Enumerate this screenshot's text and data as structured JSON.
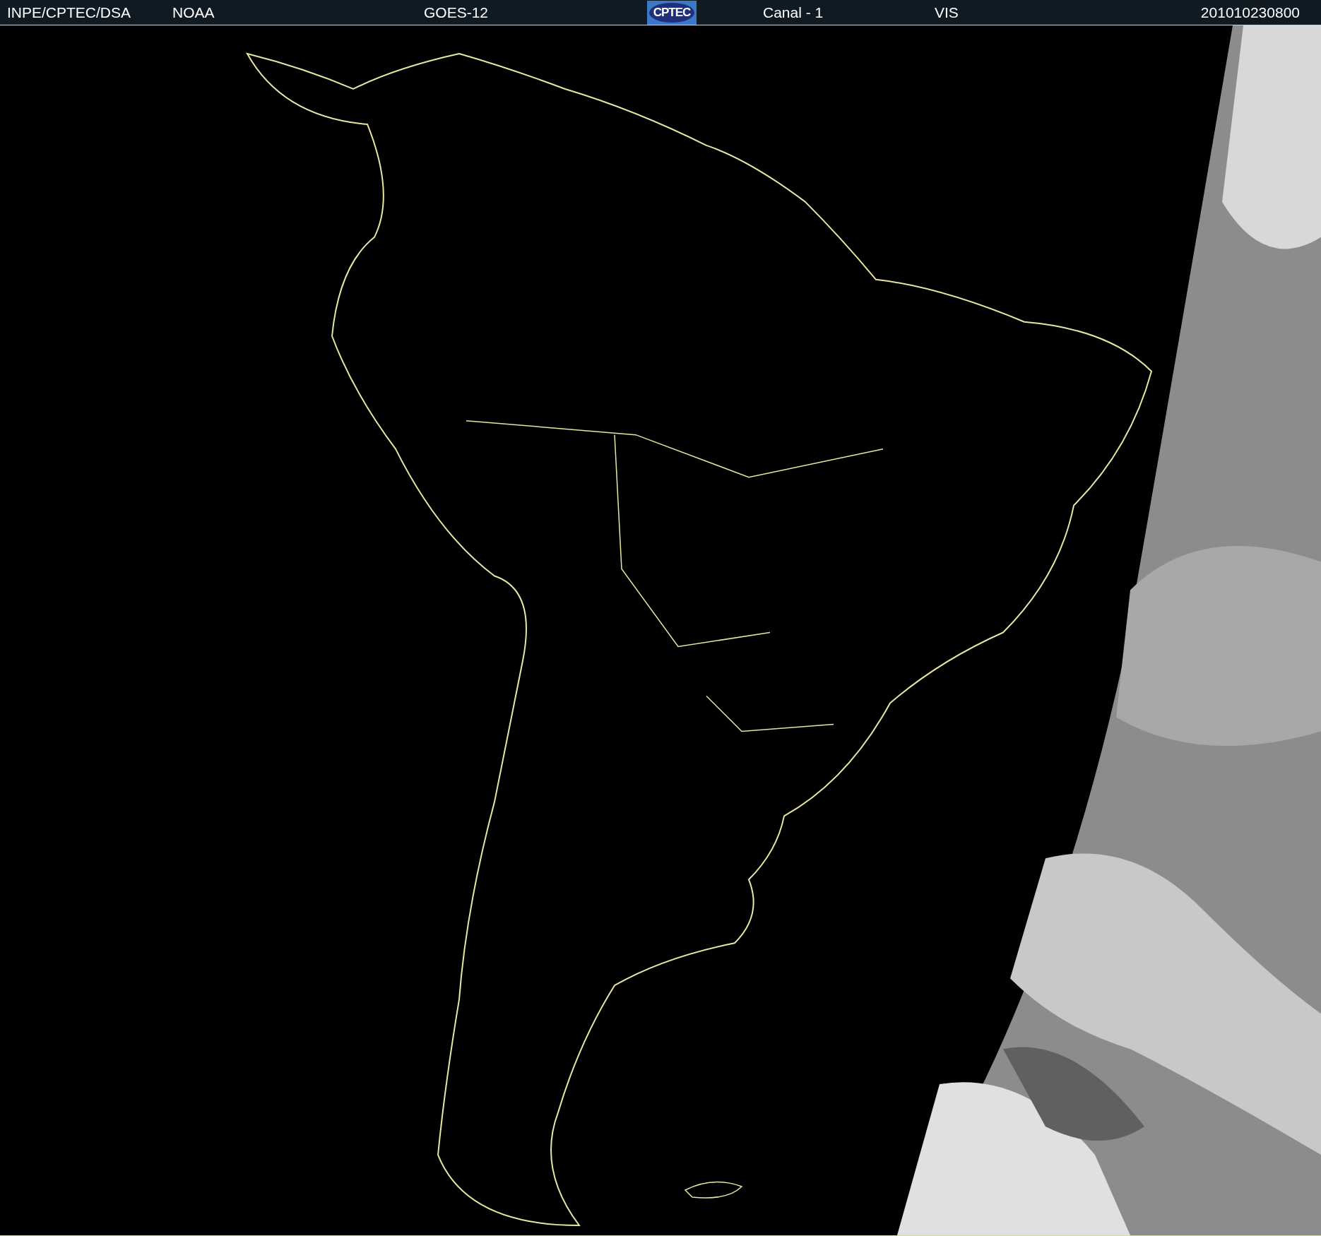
{
  "header": {
    "items": [
      {
        "kind": "text",
        "text": "INPE/CPTEC/DSA"
      },
      {
        "kind": "text",
        "text": "NOAA"
      },
      {
        "kind": "text",
        "text": "GOES-12"
      },
      {
        "kind": "logo",
        "text": "CPTEC"
      },
      {
        "kind": "text",
        "text": "Canal - 1"
      },
      {
        "kind": "text",
        "text": "VIS"
      },
      {
        "kind": "text",
        "text": "201010230800"
      }
    ]
  }
}
